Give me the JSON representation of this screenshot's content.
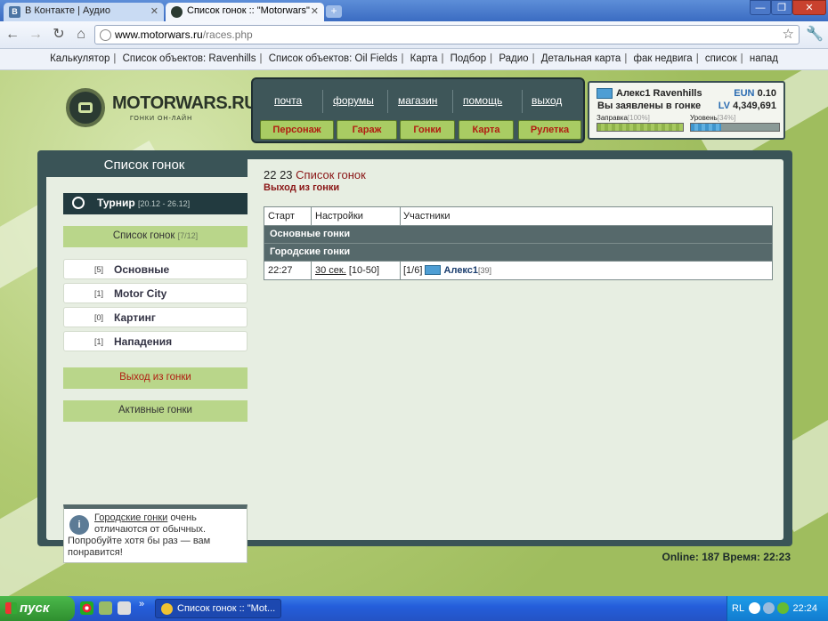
{
  "browser": {
    "tabs": [
      {
        "label": "В Контакте | Аудио",
        "active": false
      },
      {
        "label": "Список гонок :: \"Motorwars\"",
        "active": true
      }
    ],
    "url_host": "www.motorwars.ru",
    "url_path": "/races.php",
    "window_buttons": [
      "—",
      "❐",
      "✕"
    ]
  },
  "bookmarks": [
    "Калькулятор",
    "Список объектов: Ravenhills",
    "Список объектов: Oil Fields",
    "Карта",
    "Подбор",
    "Радио",
    "Детальная карта",
    "фак недвига",
    "список",
    "напад"
  ],
  "logo": {
    "title": "MOTORWARS.RU",
    "subtitle": "ГОНКИ ОН-ЛАЙН"
  },
  "topnav": {
    "links": [
      "почта",
      "форумы",
      "магазин",
      "помощь",
      "выход"
    ],
    "buttons": [
      "Персонаж",
      "Гараж",
      "Гонки",
      "Карта",
      "Рулетка"
    ]
  },
  "user": {
    "name": "Алекс1 Ravenhills",
    "status": "Вы заявлены в гонке",
    "eun_label": "EUN",
    "eun_value": "0.10",
    "lv_label": "LV",
    "lv_value": "4,349,691",
    "fuel_label": "Заправка",
    "fuel_pct_text": "[100%]",
    "fuel_fraction": 1.0,
    "level_label": "Уровень",
    "level_pct_text": "[34%]",
    "level_fraction": 0.34
  },
  "sidebar": {
    "title": "Список гонок",
    "tournament_label": "Турнир",
    "tournament_dates": "[20.12 - 26.12]",
    "race_list_label": "Список гонок",
    "race_list_count": "[7/12]",
    "categories": [
      {
        "count": "[5]",
        "label": "Основные"
      },
      {
        "count": "[1]",
        "label": "Motor City"
      },
      {
        "count": "[0]",
        "label": "Картинг"
      },
      {
        "count": "[1]",
        "label": "Нападения"
      }
    ],
    "exit_race": "Выход из гонки",
    "active_races": "Активные гонки",
    "info_link": "Городские гонки",
    "info_text": " очень отличаются от обычных. Попробуйте хотя бы раз — вам понравится!"
  },
  "main": {
    "time": "22 23",
    "title": "Список гонок",
    "exit": "Выход из гонки",
    "table_headers": [
      "Старт",
      "Настройки",
      "Участники"
    ],
    "group_main": "Основные гонки",
    "group_city": "Городские гонки",
    "row": {
      "start": "22:27",
      "settings_link": "30 сек.",
      "settings_range": "[10-50]",
      "slots": "[1/6]",
      "participant": "Алекс1",
      "participant_level": "[39]"
    }
  },
  "footer": {
    "online_label": "Online:",
    "online_value": "187",
    "time_label": "Время:",
    "time_value": "22:23"
  },
  "taskbar": {
    "start": "пуск",
    "task": "Список гонок :: \"Mot...",
    "lang": "RL",
    "clock": "22:24"
  },
  "colors": {
    "accent_red": "#b11d12",
    "panel_dark": "#3a5457",
    "green_button": "#a9cc63"
  }
}
